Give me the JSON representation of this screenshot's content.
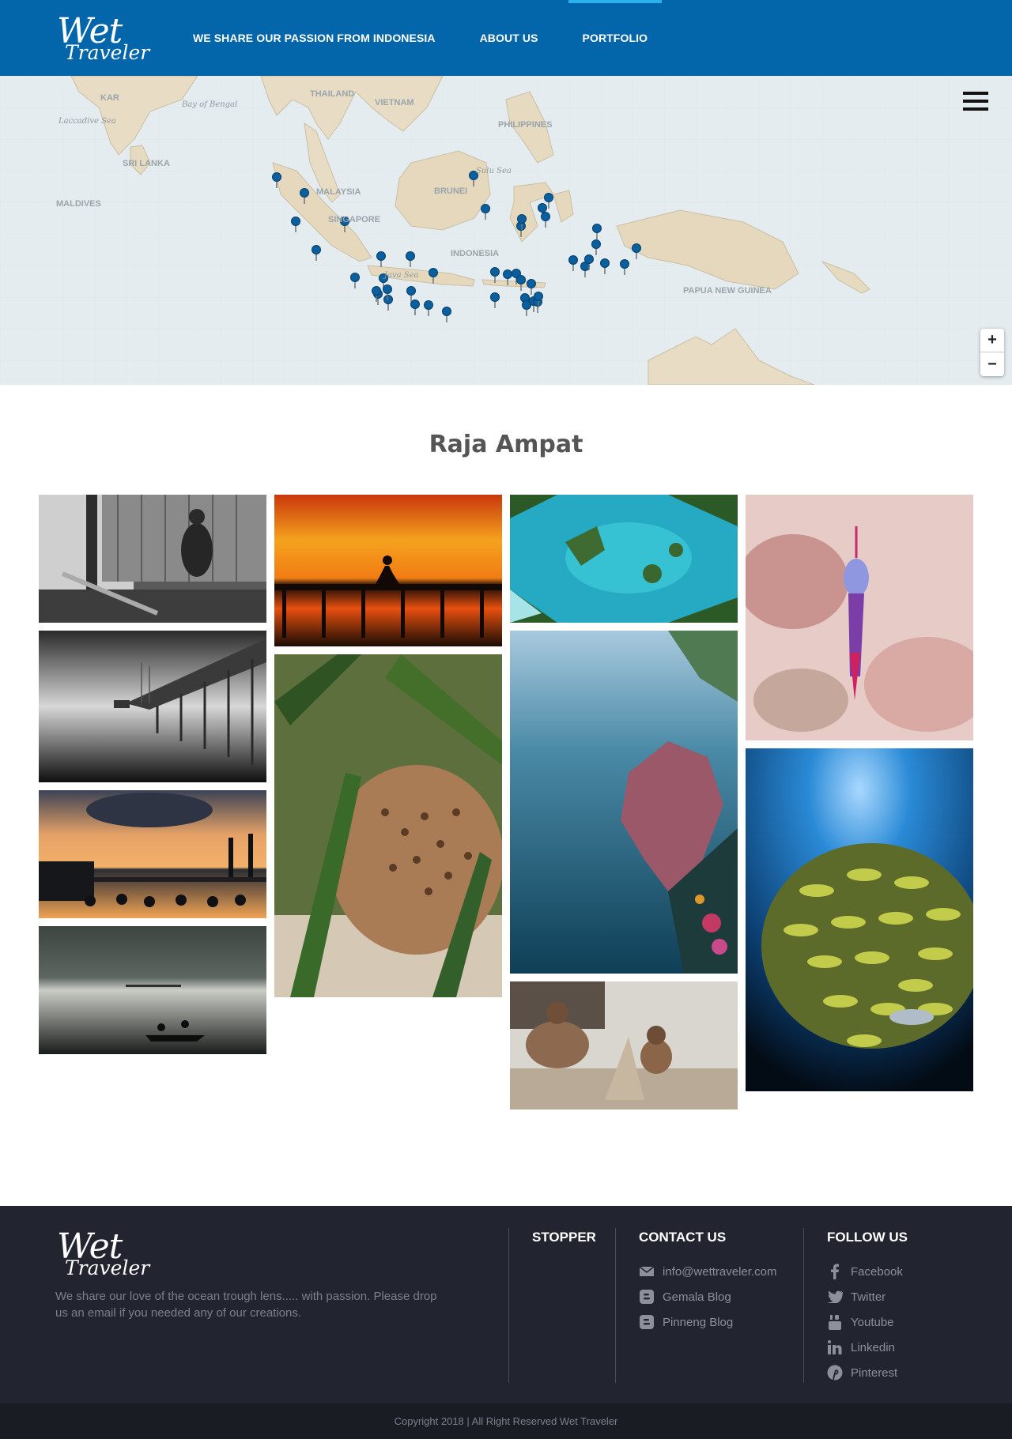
{
  "brand": {
    "logo_line1": "Wet",
    "logo_line2": "Traveler",
    "primary_color": "#0366aa",
    "accent_color": "#2bb0ee"
  },
  "nav": {
    "items": [
      {
        "label": "WE SHARE OUR PASSION FROM INDONESIA",
        "active": false
      },
      {
        "label": "ABOUT US",
        "active": false
      },
      {
        "label": "PORTFOLIO",
        "active": true
      }
    ]
  },
  "map": {
    "labels": [
      "KAR",
      "Bay of Bengal",
      "THAILAND",
      "VIETNAM",
      "Laccadive Sea",
      "PHILIPPINES",
      "SRI LANKA",
      "Sulu Sea",
      "MALAYSIA",
      "BRUNEI",
      "MALDIVES",
      "SINGAPORE",
      "INDONESIA",
      "Java Sea",
      "PAPUA NEW GUINEA"
    ],
    "marker_count": 44,
    "menu_icon": "hamburger-icon",
    "zoom_in_label": "+",
    "zoom_out_label": "−"
  },
  "section": {
    "title": "Raja Ampat"
  },
  "gallery": {
    "photos": [
      {
        "name": "photo-man-wooden-house",
        "palette": [
          "#2b2b2b",
          "#9a9a9a",
          "#d8d8d8"
        ]
      },
      {
        "name": "photo-bw-jetty",
        "palette": [
          "#111111",
          "#6a6a6a",
          "#e0e0e0"
        ]
      },
      {
        "name": "photo-people-in-water-sunset",
        "palette": [
          "#e9a25a",
          "#3a3b40",
          "#1a1a1a"
        ]
      },
      {
        "name": "photo-canoe-silver-sea",
        "palette": [
          "#4d5450",
          "#b8bcb4",
          "#1d1f1e"
        ]
      },
      {
        "name": "photo-meditation-pier-sunset",
        "palette": [
          "#f49a1f",
          "#e2360c",
          "#1c1008"
        ]
      },
      {
        "name": "photo-wobbegong-shark-seagrass",
        "palette": [
          "#3e6b2c",
          "#8c6a4c",
          "#d9cbb8"
        ]
      },
      {
        "name": "photo-aerial-lagoon",
        "palette": [
          "#2fb4c6",
          "#2f5e2a",
          "#8fe0e4"
        ]
      },
      {
        "name": "photo-soft-coral-underwater",
        "palette": [
          "#8cb7cf",
          "#1f5c73",
          "#b0586b"
        ]
      },
      {
        "name": "photo-boys-sand-castle",
        "palette": [
          "#8d7c6c",
          "#d6d2cc",
          "#3b2f27"
        ]
      },
      {
        "name": "photo-nudibranch-pink",
        "palette": [
          "#e8c4c0",
          "#c98a86",
          "#6a79d1"
        ]
      },
      {
        "name": "photo-school-of-sweetlips",
        "palette": [
          "#1a79c4",
          "#0a2240",
          "#c9d24c"
        ]
      }
    ]
  },
  "footer": {
    "description": "We share our love of the ocean trough lens..... with passion. Please drop us an email if you needed any of our creations.",
    "stopper": {
      "heading": "STOPPER"
    },
    "contact": {
      "heading": "CONTACT US",
      "links": [
        {
          "label": "info@wettraveler.com",
          "icon": "envelope-icon"
        },
        {
          "label": "Gemala Blog",
          "icon": "blogger-icon"
        },
        {
          "label": "Pinneng Blog",
          "icon": "blogger-icon"
        }
      ]
    },
    "follow": {
      "heading": "FOLLOW US",
      "links": [
        {
          "label": "Facebook",
          "icon": "facebook-icon"
        },
        {
          "label": "Twitter",
          "icon": "twitter-icon"
        },
        {
          "label": "Youtube",
          "icon": "youtube-icon"
        },
        {
          "label": "Linkedin",
          "icon": "linkedin-icon"
        },
        {
          "label": "Pinterest",
          "icon": "pinterest-icon"
        }
      ]
    },
    "copyright": "Copyright 2018 | All Right Reserved Wet Traveler"
  }
}
